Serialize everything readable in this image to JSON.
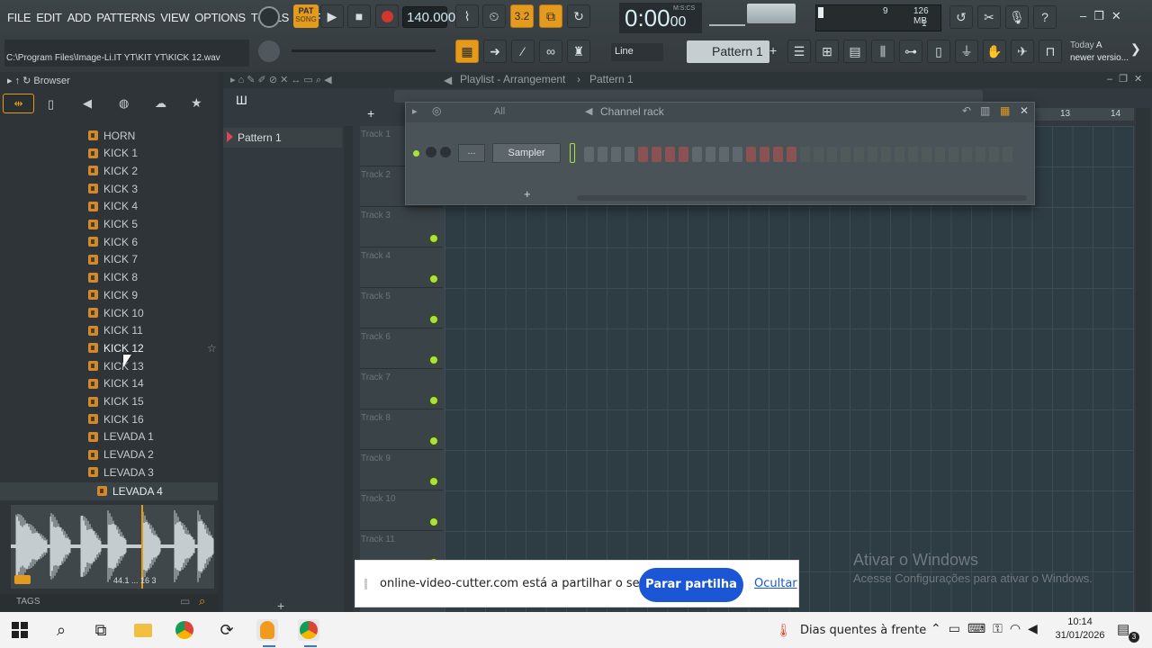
{
  "menu": [
    "FILE",
    "EDIT",
    "ADD",
    "PATTERNS",
    "VIEW",
    "OPTIONS",
    "TOOLS",
    "HELP"
  ],
  "transport": {
    "pat_label": "PAT",
    "tempo": "140.000",
    "time": "0:00",
    "time_small": "00",
    "time_unit": "M:S:CS"
  },
  "metrics": {
    "voices": "9",
    "memory": "126 MB",
    "cpu": "1"
  },
  "hint_path": "C:\\Program Files\\Image-Li.IT YT\\KIT YT\\KICK 12.wav",
  "snap": "Line",
  "pattern_selector": "Pattern 1",
  "news": {
    "line1": "Today",
    "line1b": "A",
    "line2": "newer versio..."
  },
  "browser": {
    "title": "Browser",
    "items": [
      "HORN",
      "KICK 1",
      "KICK 2",
      "KICK 3",
      "KICK 4",
      "KICK 5",
      "KICK 6",
      "KICK 7",
      "KICK 8",
      "KICK 9",
      "KICK 10",
      "KICK 11",
      "KICK 12",
      "KICK 13",
      "KICK 14",
      "KICK 15",
      "KICK 16",
      "LEVADA 1",
      "LEVADA 2",
      "LEVADA 3"
    ],
    "selected": "LEVADA 4",
    "waveform_info": "44.1 ... 16 3",
    "tags": "TAGS"
  },
  "playlist": {
    "title": "Playlist - Arrangement",
    "pattern": "Pattern 1",
    "pattern_item": "Pattern 1",
    "tracks": [
      "Track 1",
      "Track 2",
      "Track 3",
      "Track 4",
      "Track 5",
      "Track 6",
      "Track 7",
      "Track 8",
      "Track 9",
      "Track 10",
      "Track 11"
    ],
    "bar_numbers": [
      "13",
      "14"
    ]
  },
  "channel_rack": {
    "title": "Channel rack",
    "filter": "All",
    "channel": "Sampler",
    "mixer": "---"
  },
  "watermark": {
    "title": "Ativar o Windows",
    "subtitle": "Acesse Configurações para ativar o Windows."
  },
  "share_bar": {
    "text": "online-video-cutter.com está a partilhar o seu ecrã.",
    "stop": "Parar partilha",
    "hide": "Ocultar"
  },
  "taskbar": {
    "weather": "Dias quentes à frente",
    "time": "10:14",
    "date": "31/01/2026",
    "badge": "3"
  }
}
